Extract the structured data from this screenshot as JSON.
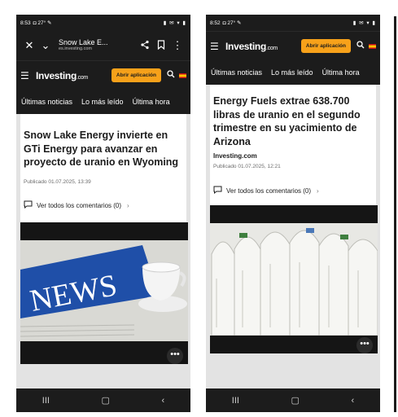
{
  "left": {
    "status_time": "8:53",
    "status_icons": "◘ 27° ✎",
    "status_right": "▮ ✉ ▾ ▮",
    "chrome_title": "Snow Lake E...",
    "chrome_url": "es.investing.com",
    "logo": "Investing",
    "logo_suffix": ".com",
    "app_button": "Abrir aplicación",
    "tabs": [
      "Últimas noticias",
      "Lo más leído",
      "Última hora"
    ],
    "headline": "Snow Lake Energy invierte en GTi Energy para avanzar en proyecto de uranio en Wyoming",
    "date": "Publicado 01.07.2025, 13:39",
    "comments": "Ver todos los comentarios (0)",
    "image_word": "NEWS"
  },
  "right": {
    "status_time": "8:52",
    "status_icons": "◘ 27° ✎",
    "status_right": "▮ ✉ ▾ ▮",
    "logo": "Investing",
    "logo_suffix": ".com",
    "app_button": "Abrir aplicación",
    "tabs": [
      "Últimas noticias",
      "Lo más leído",
      "Última hora"
    ],
    "headline": "Energy Fuels extrae 638.700 libras de uranio en el segundo trimestre en su yacimiento de Arizona",
    "byline": "Investing.com",
    "date": "Publicado 01.07.2025, 12:21",
    "comments": "Ver todos los comentarios (0)"
  },
  "icons": {
    "close": "✕",
    "chevron": "⌄",
    "share": "⟨",
    "bookmark": "▯",
    "kebab": "⋮",
    "menu": "☰",
    "search": "⌕",
    "comment": "▭",
    "chevron_right": "›",
    "more": "•••",
    "nav_recent": "III",
    "nav_home": "▢",
    "nav_back": "‹"
  },
  "colors": {
    "header_bg": "#1c1c1c",
    "accent": "#f7a11a",
    "image_blue": "#1f4fa8"
  }
}
